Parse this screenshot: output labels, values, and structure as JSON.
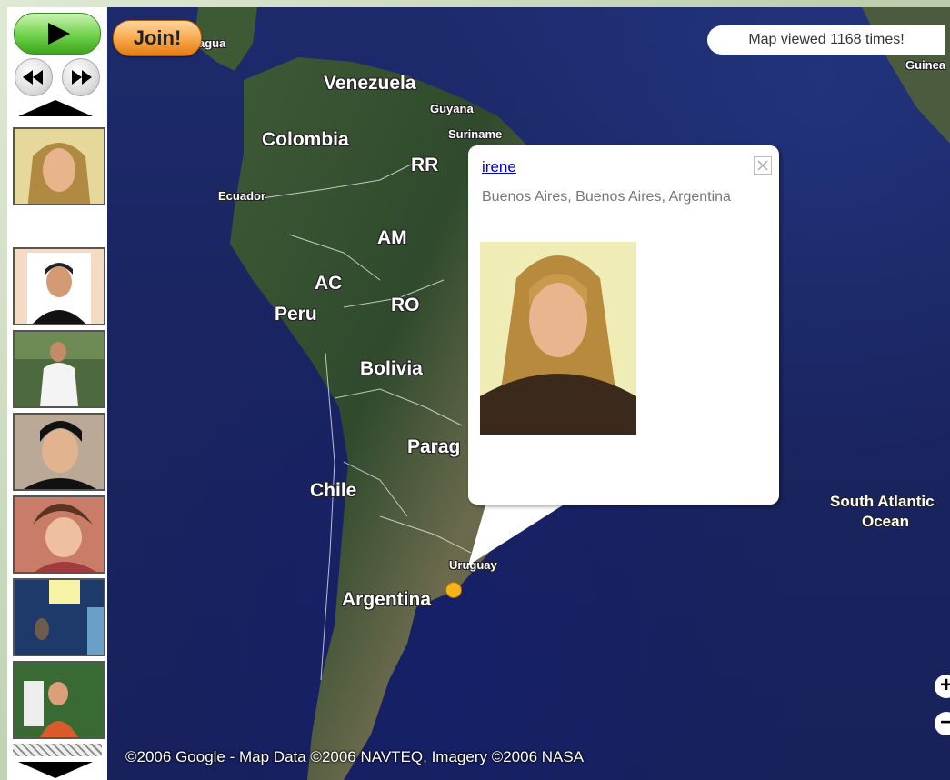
{
  "controls": {
    "join_label": "Join!"
  },
  "map": {
    "view_counter": "Map viewed 1168 times!",
    "copyright": "©2006 Google - Map Data ©2006 NAVTEQ, Imagery ©2006 NASA",
    "labels": {
      "nicaragua_partial": "agua",
      "guinea_partial": "Guinea",
      "venezuela": "Venezuela",
      "guyana": "Guyana",
      "suriname": "Suriname",
      "colombia": "Colombia",
      "rr": "RR",
      "ecuador": "Ecuador",
      "am": "AM",
      "ac": "AC",
      "ro": "RO",
      "peru": "Peru",
      "bolivia": "Bolivia",
      "paraguay_partial": "Parag",
      "chile": "Chile",
      "uruguay": "Uruguay",
      "argentina": "Argentina",
      "south_atlantic_1": "South Atlantic",
      "south_atlantic_2": "Ocean"
    },
    "zoom_in": "+",
    "zoom_out": "−"
  },
  "info_window": {
    "name": "irene",
    "location": "Buenos Aires, Buenos Aires, Argentina"
  },
  "sidebar": {
    "thumbnails": [
      "user-1",
      "user-2",
      "user-3",
      "user-4",
      "user-5",
      "user-6",
      "user-7"
    ]
  }
}
